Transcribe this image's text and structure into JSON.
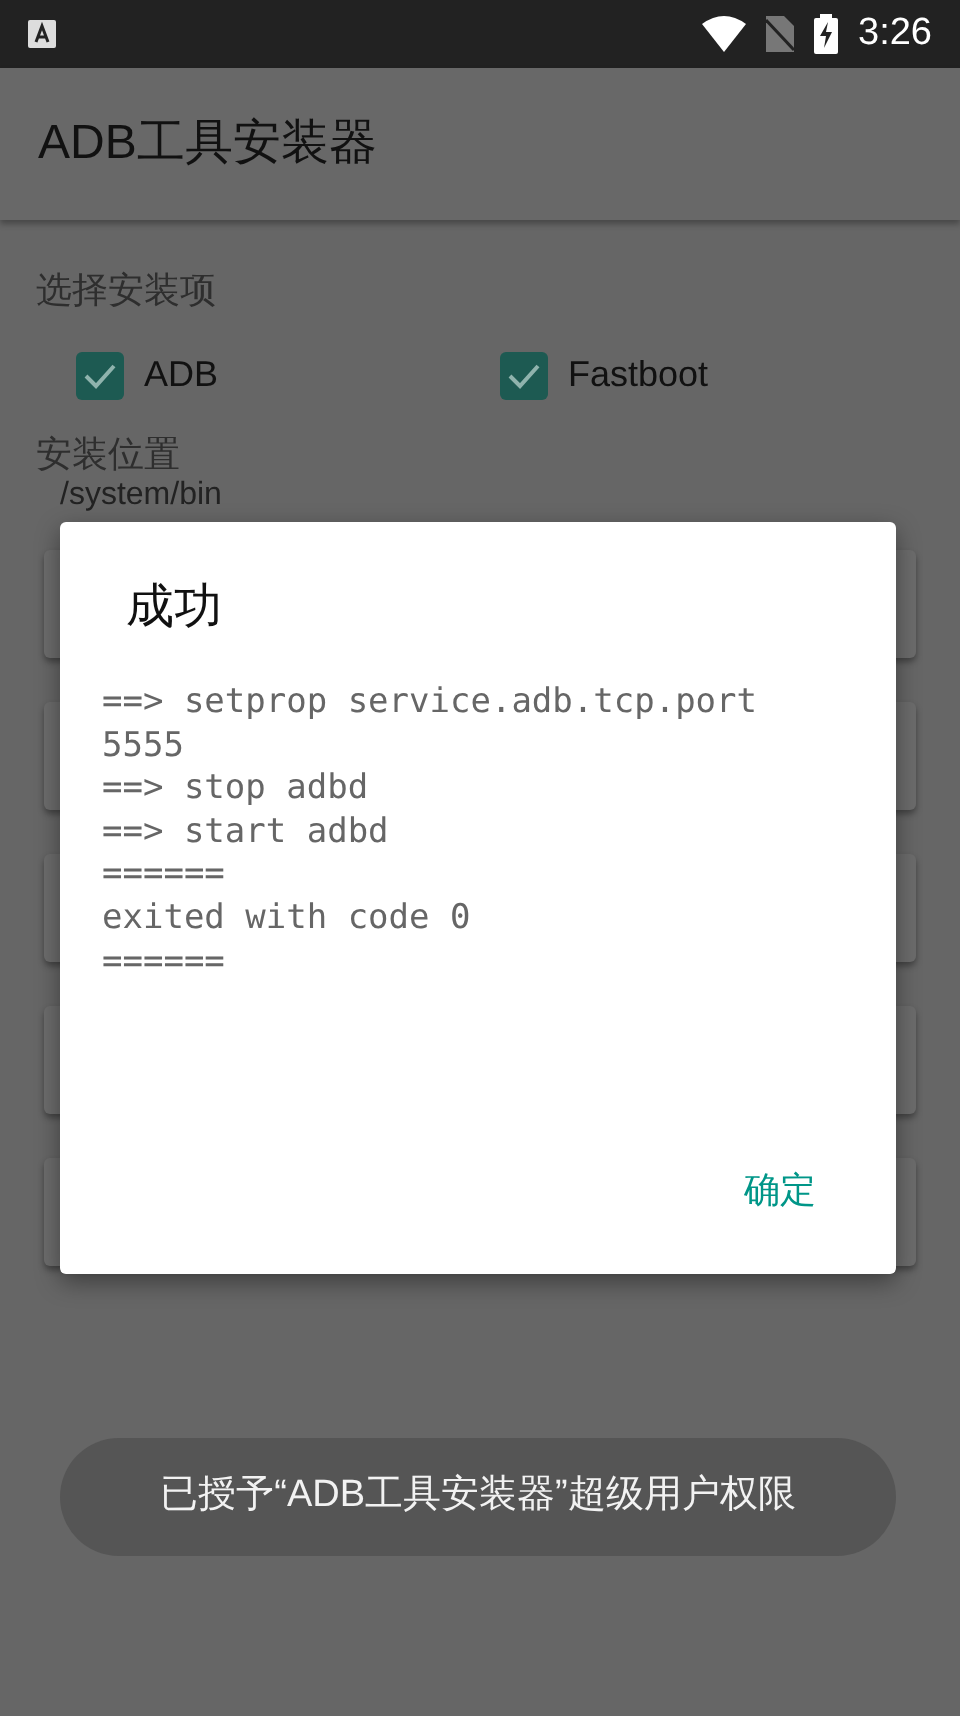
{
  "status_bar": {
    "time": "3:26"
  },
  "app_bar": {
    "title": "ADB工具安装器"
  },
  "install_items": {
    "label": "选择安装项",
    "options": [
      {
        "label": "ADB",
        "checked": true
      },
      {
        "label": "Fastboot",
        "checked": true
      }
    ]
  },
  "install_location": {
    "label": "安装位置",
    "path": "/system/bin"
  },
  "dialog": {
    "title": "成功",
    "output": [
      "==> setprop service.adb.tcp.port",
      "5555",
      "==> stop adbd",
      "==> start adbd",
      "======",
      "exited with code 0",
      "======"
    ],
    "button": "确定"
  },
  "toast": {
    "text": "已授予“ADB工具安装器”超级用户权限"
  }
}
